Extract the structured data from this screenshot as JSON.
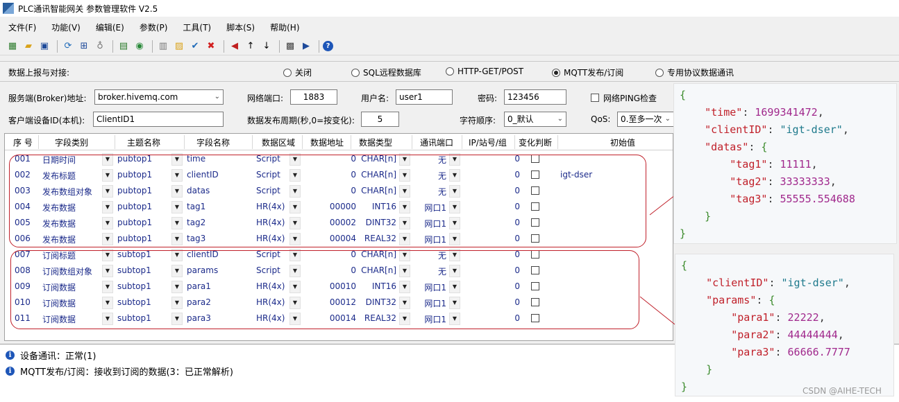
{
  "title": "PLC通讯智能网关 参数管理软件 V2.5",
  "menu": [
    "文件(F)",
    "功能(V)",
    "编辑(E)",
    "参数(P)",
    "工具(T)",
    "脚本(S)",
    "帮助(H)"
  ],
  "report": {
    "label": "数据上报与对接:",
    "options": [
      "关闭",
      "SQL远程数据库",
      "HTTP-GET/POST",
      "MQTT发布/订阅",
      "专用协议数据通讯"
    ],
    "selected": "MQTT发布/订阅"
  },
  "settings": {
    "broker_label": "服务端(Broker)地址:",
    "broker_value": "broker.hivemq.com",
    "port_label": "网络端口:",
    "port_value": "1883",
    "user_label": "用户名:",
    "user_value": "user1",
    "pwd_label": "密码:",
    "pwd_value": "123456",
    "ping_label": "网络PING检查",
    "client_label": "客户端设备ID(本机):",
    "client_value": "ClientID1",
    "period_label": "数据发布周期(秒,0=按变化):",
    "period_value": "5",
    "order_label": "字符顺序:",
    "order_value": "0_默认",
    "qos_label": "QoS:",
    "qos_value": "0.至多一次"
  },
  "grid": {
    "headers": [
      "序 号",
      "字段类别",
      "主题名称",
      "字段名称",
      "数据区域",
      "数据地址",
      "数据类型",
      "通讯端口",
      "IP/站号/组",
      "变化判断",
      "初始值"
    ],
    "rows": [
      {
        "no": "001",
        "cat": "日期时间",
        "topic": "pubtop1",
        "field": "time",
        "area": "Script",
        "addr": "0",
        "type": "CHAR[n]",
        "port": "无",
        "ip": "0",
        "init": ""
      },
      {
        "no": "002",
        "cat": "发布标题",
        "topic": "pubtop1",
        "field": "clientID",
        "area": "Script",
        "addr": "0",
        "type": "CHAR[n]",
        "port": "无",
        "ip": "0",
        "init": "igt-dser"
      },
      {
        "no": "003",
        "cat": "发布数组对象",
        "topic": "pubtop1",
        "field": "datas",
        "area": "Script",
        "addr": "0",
        "type": "CHAR[n]",
        "port": "无",
        "ip": "0",
        "init": ""
      },
      {
        "no": "004",
        "cat": "发布数据",
        "topic": "pubtop1",
        "field": "tag1",
        "area": "HR(4x)",
        "addr": "00000",
        "type": "INT16",
        "port": "网口1",
        "ip": "0",
        "init": ""
      },
      {
        "no": "005",
        "cat": "发布数据",
        "topic": "pubtop1",
        "field": "tag2",
        "area": "HR(4x)",
        "addr": "00002",
        "type": "DINT32",
        "port": "网口1",
        "ip": "0",
        "init": ""
      },
      {
        "no": "006",
        "cat": "发布数据",
        "topic": "pubtop1",
        "field": "tag3",
        "area": "HR(4x)",
        "addr": "00004",
        "type": "REAL32",
        "port": "网口1",
        "ip": "0",
        "init": ""
      },
      {
        "no": "007",
        "cat": "订阅标题",
        "topic": "subtop1",
        "field": "clientID",
        "area": "Script",
        "addr": "0",
        "type": "CHAR[n]",
        "port": "无",
        "ip": "0",
        "init": ""
      },
      {
        "no": "008",
        "cat": "订阅数组对象",
        "topic": "subtop1",
        "field": "params",
        "area": "Script",
        "addr": "0",
        "type": "CHAR[n]",
        "port": "无",
        "ip": "0",
        "init": ""
      },
      {
        "no": "009",
        "cat": "订阅数据",
        "topic": "subtop1",
        "field": "para1",
        "area": "HR(4x)",
        "addr": "00010",
        "type": "INT16",
        "port": "网口1",
        "ip": "0",
        "init": ""
      },
      {
        "no": "010",
        "cat": "订阅数据",
        "topic": "subtop1",
        "field": "para2",
        "area": "HR(4x)",
        "addr": "00012",
        "type": "DINT32",
        "port": "网口1",
        "ip": "0",
        "init": ""
      },
      {
        "no": "011",
        "cat": "订阅数据",
        "topic": "subtop1",
        "field": "para3",
        "area": "HR(4x)",
        "addr": "00014",
        "type": "REAL32",
        "port": "网口1",
        "ip": "0",
        "init": ""
      }
    ]
  },
  "log": [
    "设备通讯：正常(1)",
    "MQTT发布/订阅：接收到订阅的数据(3：已正常解析)"
  ],
  "json_pub": {
    "open": "{",
    "time_key": "\"time\"",
    "time_val": "1699341472",
    "client_key": "\"clientID\"",
    "client_val": "\"igt-dser\"",
    "datas_key": "\"datas\"",
    "tag1_key": "\"tag1\"",
    "tag1_val": "11111",
    "tag2_key": "\"tag2\"",
    "tag2_val": "33333333",
    "tag3_key": "\"tag3\"",
    "tag3_val": "55555.554688",
    "inner_close": "}",
    "close": "}"
  },
  "json_sub": {
    "open": "{",
    "client_key": "\"clientID\"",
    "client_val": "\"igt-dser\"",
    "params_key": "\"params\"",
    "para1_key": "\"para1\"",
    "para1_val": "22222",
    "para2_key": "\"para2\"",
    "para2_val": "44444444",
    "para3_key": "\"para3\"",
    "para3_val": "66666.7777",
    "inner_close": "}",
    "close": "}"
  },
  "watermark": "CSDN @AIHE-TECH",
  "colors": {
    "highlight": "#c0202a",
    "grid_text": "#1b2a8a",
    "json_key": "#c0202a"
  }
}
